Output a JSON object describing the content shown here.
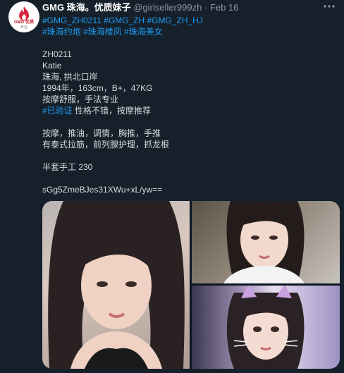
{
  "tweet": {
    "display_name": "GMG 珠海。优质妹子",
    "handle": "@girlseller999zh",
    "separator": "·",
    "date": "Feb 16",
    "more_icon": "more-icon",
    "avatar": {
      "brand_text": "GMG 优质",
      "sub_text": "专业"
    },
    "hashtags_line1": "#GMG_ZH0211 #GMG_ZH #GMG_ZH_HJ",
    "hashtags_line2": "#珠海约炮 #珠海楼凤 #珠海美女",
    "lines": {
      "code": "ZH0211",
      "name": "Katie",
      "location": "珠海, 拱北口岸",
      "stats": "1994年，163cm，B+，47KG",
      "service_quality": "按摩舒服，手法专业",
      "verified_tag": "#已验证",
      "verified_rest": " 性格不错，按摩推荐",
      "services_1": "按摩，推油，调情，胸推，手推",
      "services_2": "有泰式拉筋，前列腺护理，抓龙根",
      "price": "半套手工 230",
      "hash": "sGg5ZmeBJes31XWu+xL/yw=="
    },
    "media": {
      "photos": [
        "photo",
        "photo",
        "photo"
      ]
    },
    "colors": {
      "background": "#15202b",
      "link": "#1d9bf0",
      "muted": "#8b98a5",
      "text": "#d9d9d9"
    }
  }
}
